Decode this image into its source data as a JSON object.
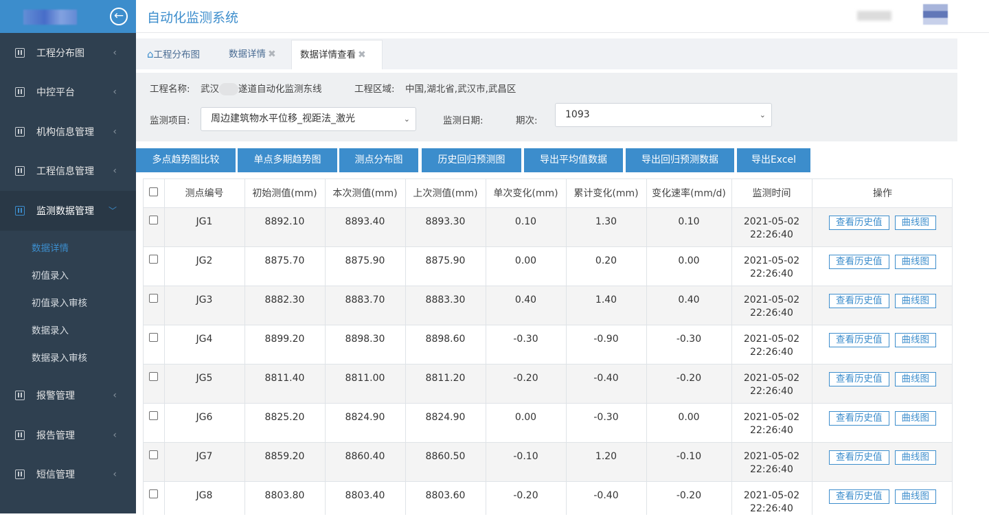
{
  "app": {
    "title": "自动化监测系统",
    "back_icon": "arrow-left-circle-icon"
  },
  "sidebar": {
    "items": [
      {
        "label": "工程分布图",
        "active": false
      },
      {
        "label": "中控平台",
        "active": false
      },
      {
        "label": "机构信息管理",
        "active": false
      },
      {
        "label": "工程信息管理",
        "active": false
      },
      {
        "label": "监测数据管理",
        "active": true,
        "sub": [
          {
            "label": "数据详情",
            "active": true
          },
          {
            "label": "初值录入",
            "active": false
          },
          {
            "label": "初值录入审核",
            "active": false
          },
          {
            "label": "数据录入",
            "active": false
          },
          {
            "label": "数据录入审核",
            "active": false
          }
        ]
      },
      {
        "label": "报警管理",
        "active": false
      },
      {
        "label": "报告管理",
        "active": false
      },
      {
        "label": "短信管理",
        "active": false
      }
    ],
    "collapsed_arrow": "‹",
    "expanded_arrow": "﹀"
  },
  "tabs": [
    {
      "label": "工程分布图",
      "icon": "home-icon",
      "closable": false
    },
    {
      "label": "数据详情",
      "closable": true
    },
    {
      "label": "数据详情查看",
      "closable": true,
      "active": true
    }
  ],
  "filter": {
    "project_label": "工程名称:",
    "project_value_prefix": "武汉",
    "project_value_suffix": "遂道自动化监测东线",
    "region_label": "工程区域:",
    "region_value": "中国,湖北省,武汉市,武昌区",
    "item_label": "监测项目:",
    "item_value": "周边建筑物水平位移_视距法_激光",
    "date_label": "监测日期:",
    "period_label": "期次:",
    "period_value": "1093"
  },
  "buttons": [
    "多点趋势图比较",
    "单点多期趋势图",
    "测点分布图",
    "历史回归预测图",
    "导出平均值数据",
    "导出回归预测数据",
    "导出Excel"
  ],
  "table": {
    "headers": [
      "测点编号",
      "初始测值(mm)",
      "本次测值(mm)",
      "上次测值(mm)",
      "单次变化(mm)",
      "累计变化(mm)",
      "变化速率(mm/d)",
      "监测时间",
      "操作"
    ],
    "op_history": "查看历史值",
    "op_curve": "曲线图",
    "rows": [
      {
        "id": "JG1",
        "initial": "8892.10",
        "current": "8893.40",
        "previous": "8893.30",
        "single": "0.10",
        "cumulative": "1.30",
        "rate": "0.10",
        "date": "2021-05-02",
        "time": "22:26:40"
      },
      {
        "id": "JG2",
        "initial": "8875.70",
        "current": "8875.90",
        "previous": "8875.90",
        "single": "0.00",
        "cumulative": "0.20",
        "rate": "0.00",
        "date": "2021-05-02",
        "time": "22:26:40"
      },
      {
        "id": "JG3",
        "initial": "8882.30",
        "current": "8883.70",
        "previous": "8883.30",
        "single": "0.40",
        "cumulative": "1.40",
        "rate": "0.40",
        "date": "2021-05-02",
        "time": "22:26:40"
      },
      {
        "id": "JG4",
        "initial": "8899.20",
        "current": "8898.30",
        "previous": "8898.60",
        "single": "-0.30",
        "cumulative": "-0.90",
        "rate": "-0.30",
        "date": "2021-05-02",
        "time": "22:26:40"
      },
      {
        "id": "JG5",
        "initial": "8811.40",
        "current": "8811.00",
        "previous": "8811.20",
        "single": "-0.20",
        "cumulative": "-0.40",
        "rate": "-0.20",
        "date": "2021-05-02",
        "time": "22:26:40"
      },
      {
        "id": "JG6",
        "initial": "8825.20",
        "current": "8824.90",
        "previous": "8824.90",
        "single": "0.00",
        "cumulative": "-0.30",
        "rate": "0.00",
        "date": "2021-05-02",
        "time": "22:26:40"
      },
      {
        "id": "JG7",
        "initial": "8859.20",
        "current": "8860.40",
        "previous": "8860.50",
        "single": "-0.10",
        "cumulative": "1.20",
        "rate": "-0.10",
        "date": "2021-05-02",
        "time": "22:26:40"
      },
      {
        "id": "JG8",
        "initial": "8803.80",
        "current": "8803.40",
        "previous": "8803.60",
        "single": "-0.20",
        "cumulative": "-0.40",
        "rate": "-0.20",
        "date": "2021-05-02",
        "time": "22:26:40"
      }
    ]
  },
  "colors": {
    "accent": "#3c8dcc",
    "sidebar_bg": "#2f4050",
    "sidebar_active_bg": "#293846"
  }
}
